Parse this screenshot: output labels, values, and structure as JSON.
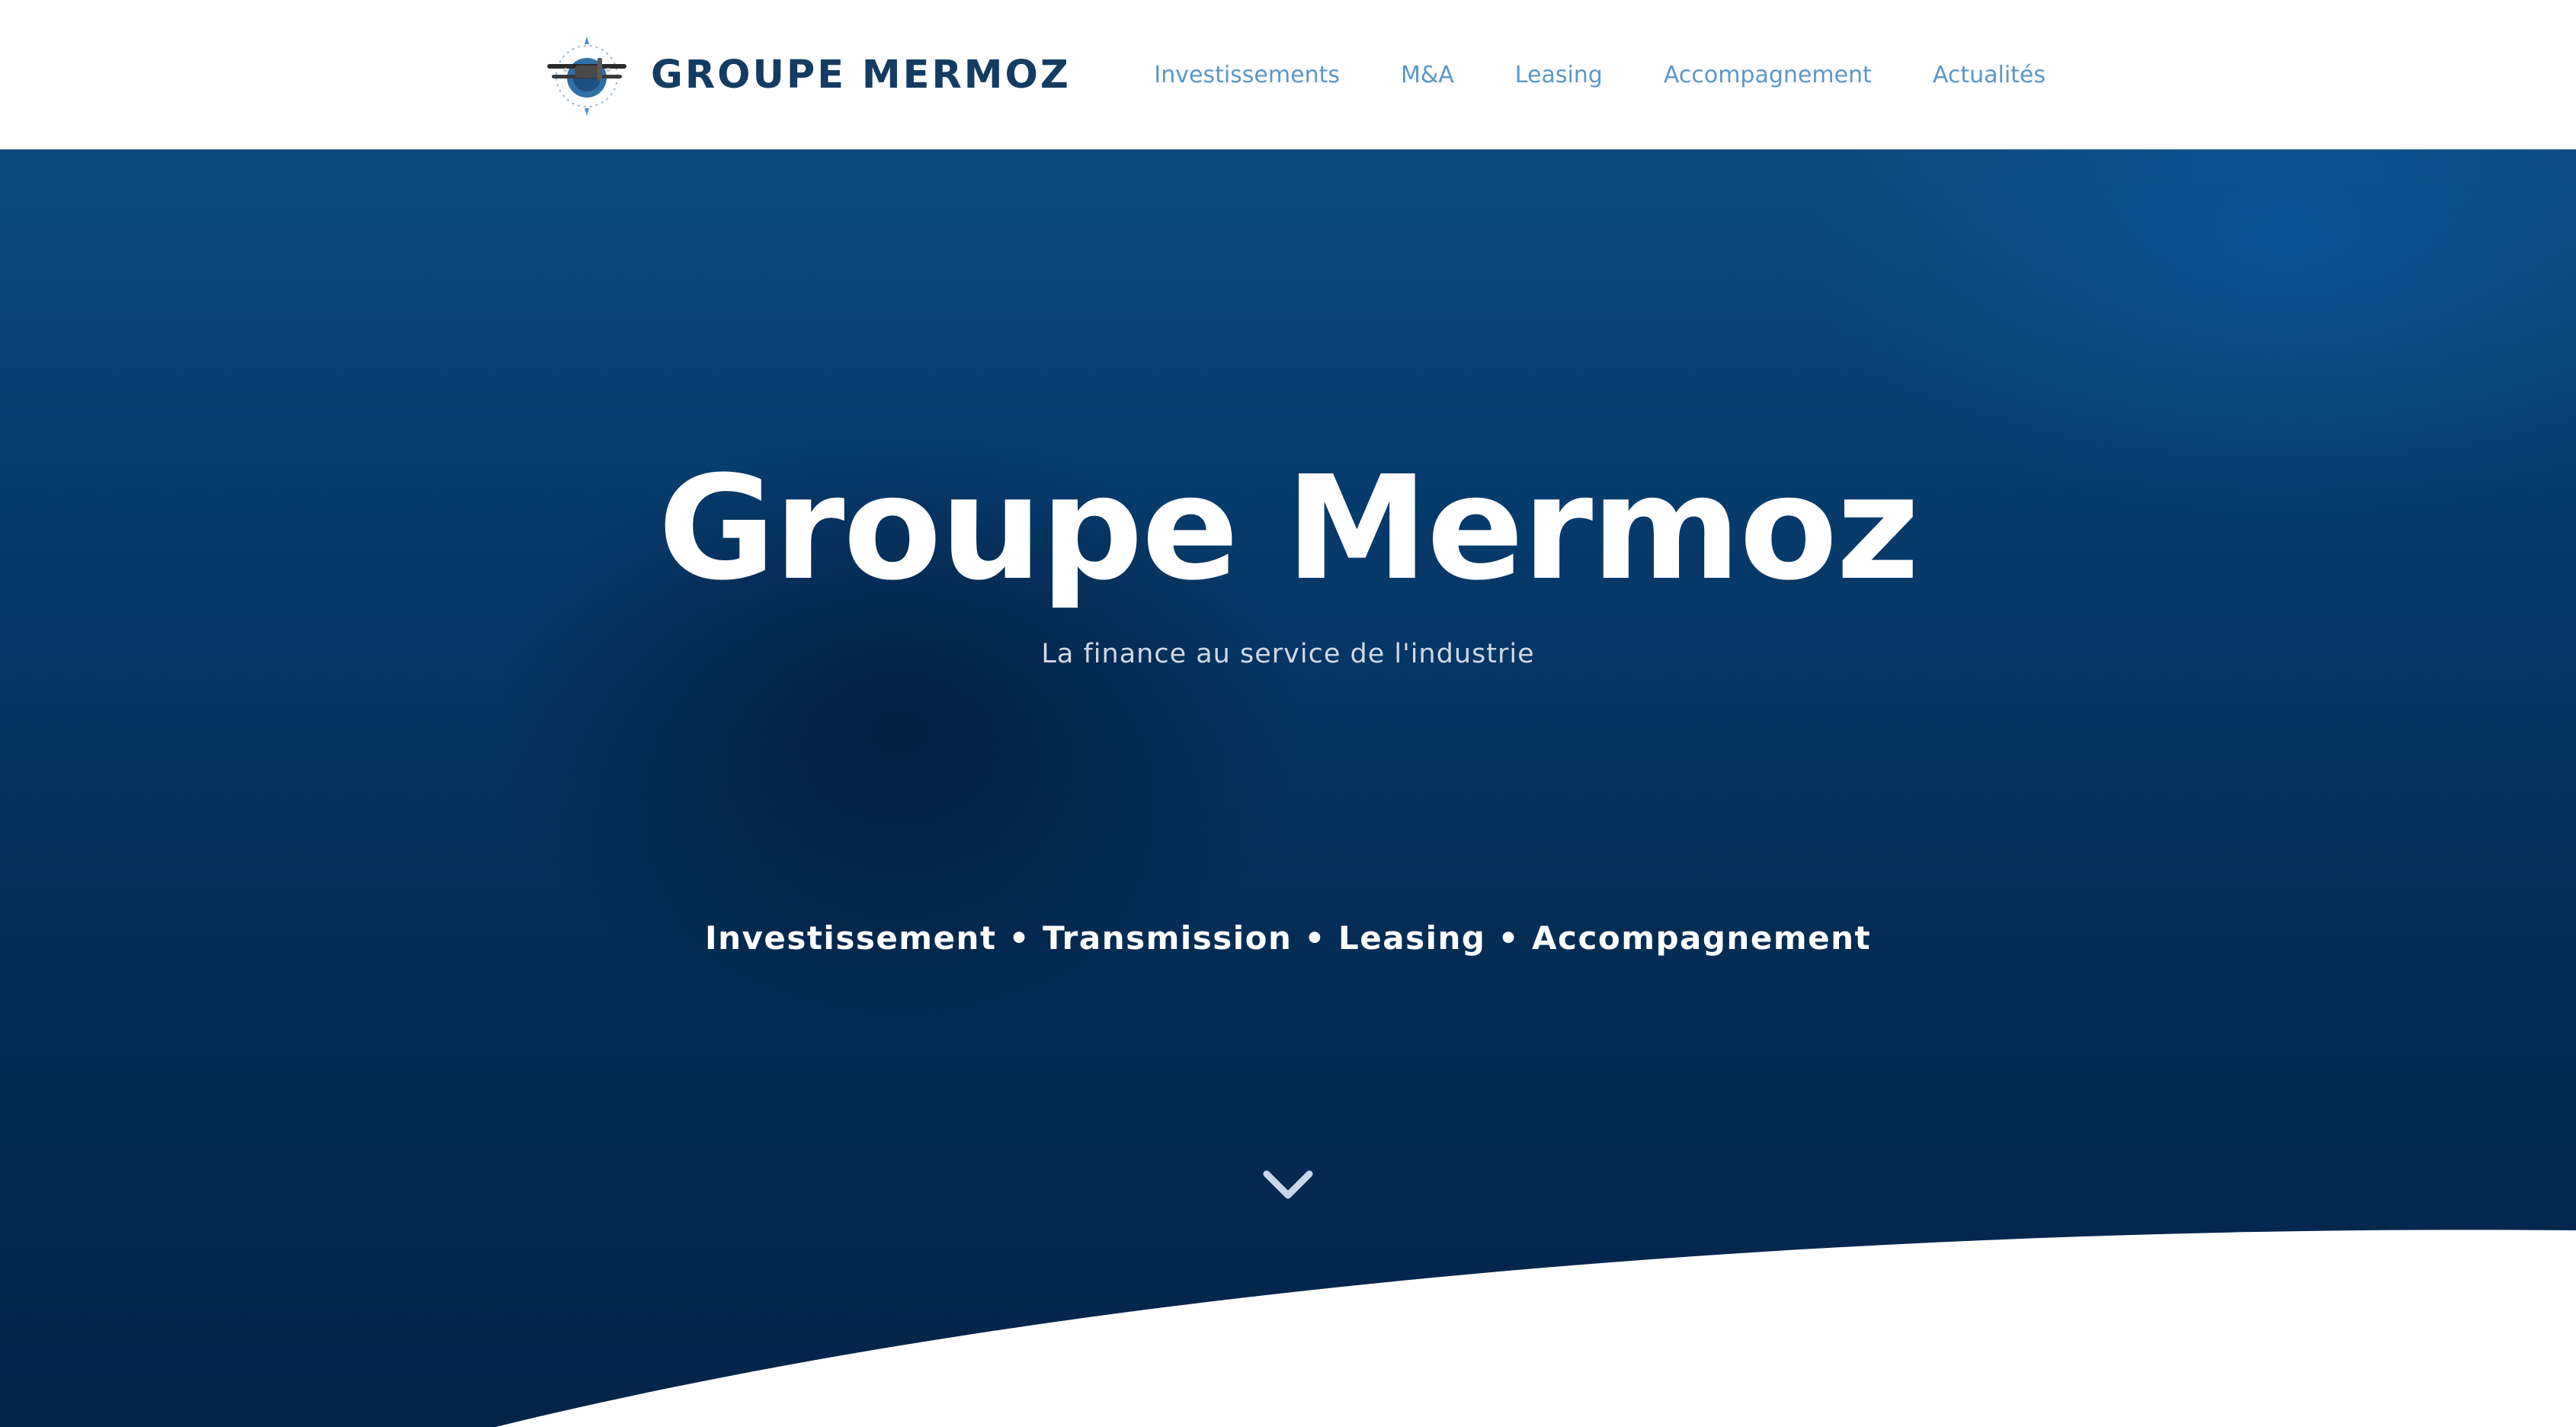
{
  "header": {
    "brand_name": "GROUPE MERMOZ",
    "logo_icon": "propeller-plane-compass-logo",
    "nav_items": [
      {
        "label": "Investissements"
      },
      {
        "label": "M&A"
      },
      {
        "label": "Leasing"
      },
      {
        "label": "Accompagnement"
      },
      {
        "label": "Actualités"
      }
    ]
  },
  "hero": {
    "title": "Groupe Mermoz",
    "subtitle": "La finance au service de l'industrie",
    "tagline": "Investissement • Transmission • Leasing • Accompagnement",
    "scroll_icon": "chevron-down-icon"
  },
  "colors": {
    "brand": "#123c63",
    "nav_link": "#5b97c7",
    "hero_background": "#063a6b",
    "hero_text": "#ffffff"
  }
}
